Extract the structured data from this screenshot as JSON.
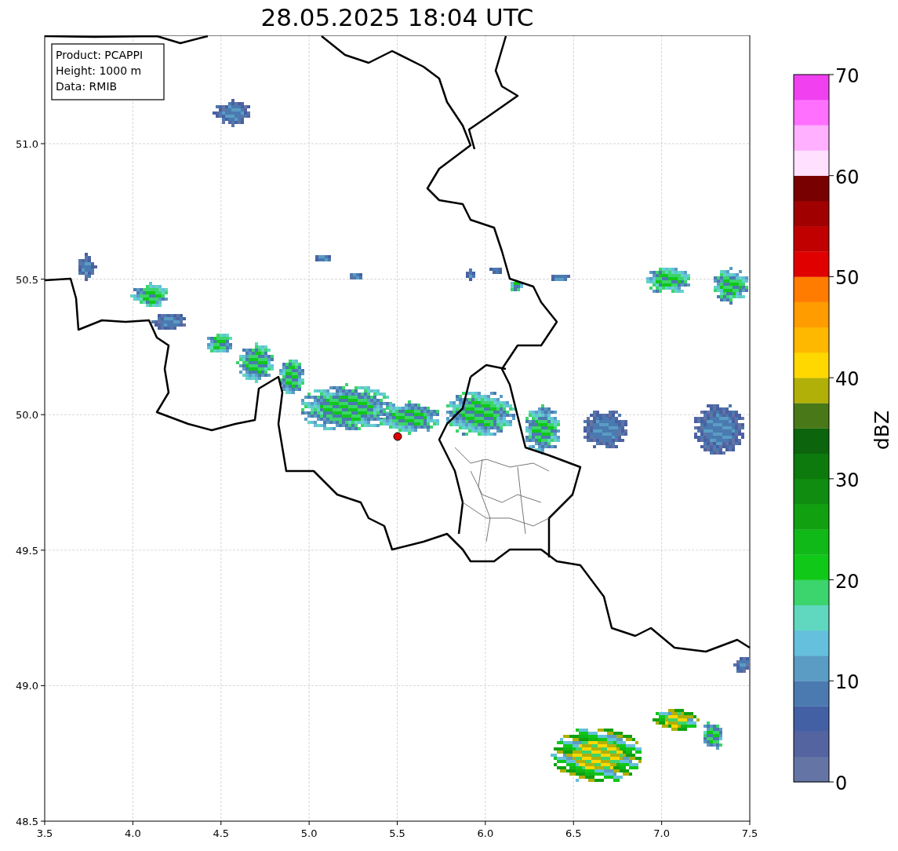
{
  "title": "28.05.2025 18:04 UTC",
  "info_box": [
    "Product: PCAPPI",
    "Height: 1000 m",
    "Data: RMIB"
  ],
  "x_axis": {
    "ticks": [
      "3.5",
      "4.0",
      "4.5",
      "5.0",
      "5.5",
      "6.0",
      "6.5",
      "7.0",
      "7.5"
    ]
  },
  "y_axis": {
    "ticks": [
      "51.0",
      "50.5",
      "50.0",
      "49.5",
      "49.0",
      "48.5"
    ]
  },
  "colorbar": {
    "label": "dBZ",
    "ticks": [
      "70",
      "60",
      "50",
      "40",
      "30",
      "20",
      "10",
      "0"
    ],
    "bins": [
      {
        "color": "#6474a4"
      },
      {
        "color": "#5464a0"
      },
      {
        "color": "#4460a4"
      },
      {
        "color": "#4a7ab0"
      },
      {
        "color": "#5a9cc4"
      },
      {
        "color": "#64c0dc"
      },
      {
        "color": "#60d8c0"
      },
      {
        "color": "#3cd46c"
      },
      {
        "color": "#10c818"
      },
      {
        "color": "#10b818"
      },
      {
        "color": "#10a010"
      },
      {
        "color": "#108c10"
      },
      {
        "color": "#0c7a0c"
      },
      {
        "color": "#0c640c"
      },
      {
        "color": "#487818"
      },
      {
        "color": "#b0b008"
      },
      {
        "color": "#ffd800"
      },
      {
        "color": "#ffb800"
      },
      {
        "color": "#ff9c00"
      },
      {
        "color": "#ff7c00"
      },
      {
        "color": "#e00000"
      },
      {
        "color": "#c00000"
      },
      {
        "color": "#a00000"
      },
      {
        "color": "#780000"
      },
      {
        "color": "#ffe0ff"
      },
      {
        "color": "#ffb0ff"
      },
      {
        "color": "#ff70ff"
      },
      {
        "color": "#f040f0"
      }
    ]
  }
}
